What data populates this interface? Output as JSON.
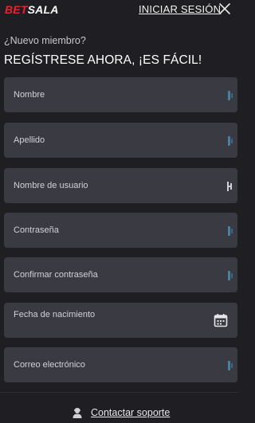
{
  "brand": {
    "logo_part1": "BET",
    "logo_part2": "SALA",
    "accent": "#e1262d"
  },
  "header": {
    "login_link": "INICIAR SESIÓN",
    "close_icon": "close-icon"
  },
  "intro": {
    "subtitle": "¿Nuevo miembro?",
    "headline": "REGÍSTRESE AHORA, ¡ES FÁCIL!"
  },
  "form": {
    "fields": [
      {
        "label": "Nombre"
      },
      {
        "label": "Apellido"
      },
      {
        "label": "Nombre de usuario"
      },
      {
        "label": "Contraseña"
      },
      {
        "label": "Confirmar contraseña"
      },
      {
        "label": "Fecha de nacimiento",
        "icon": "calendar-icon"
      },
      {
        "label": "Correo electrónico"
      }
    ]
  },
  "footer": {
    "support_link": "Contactar soporte",
    "support_icon": "support-agent-icon"
  }
}
